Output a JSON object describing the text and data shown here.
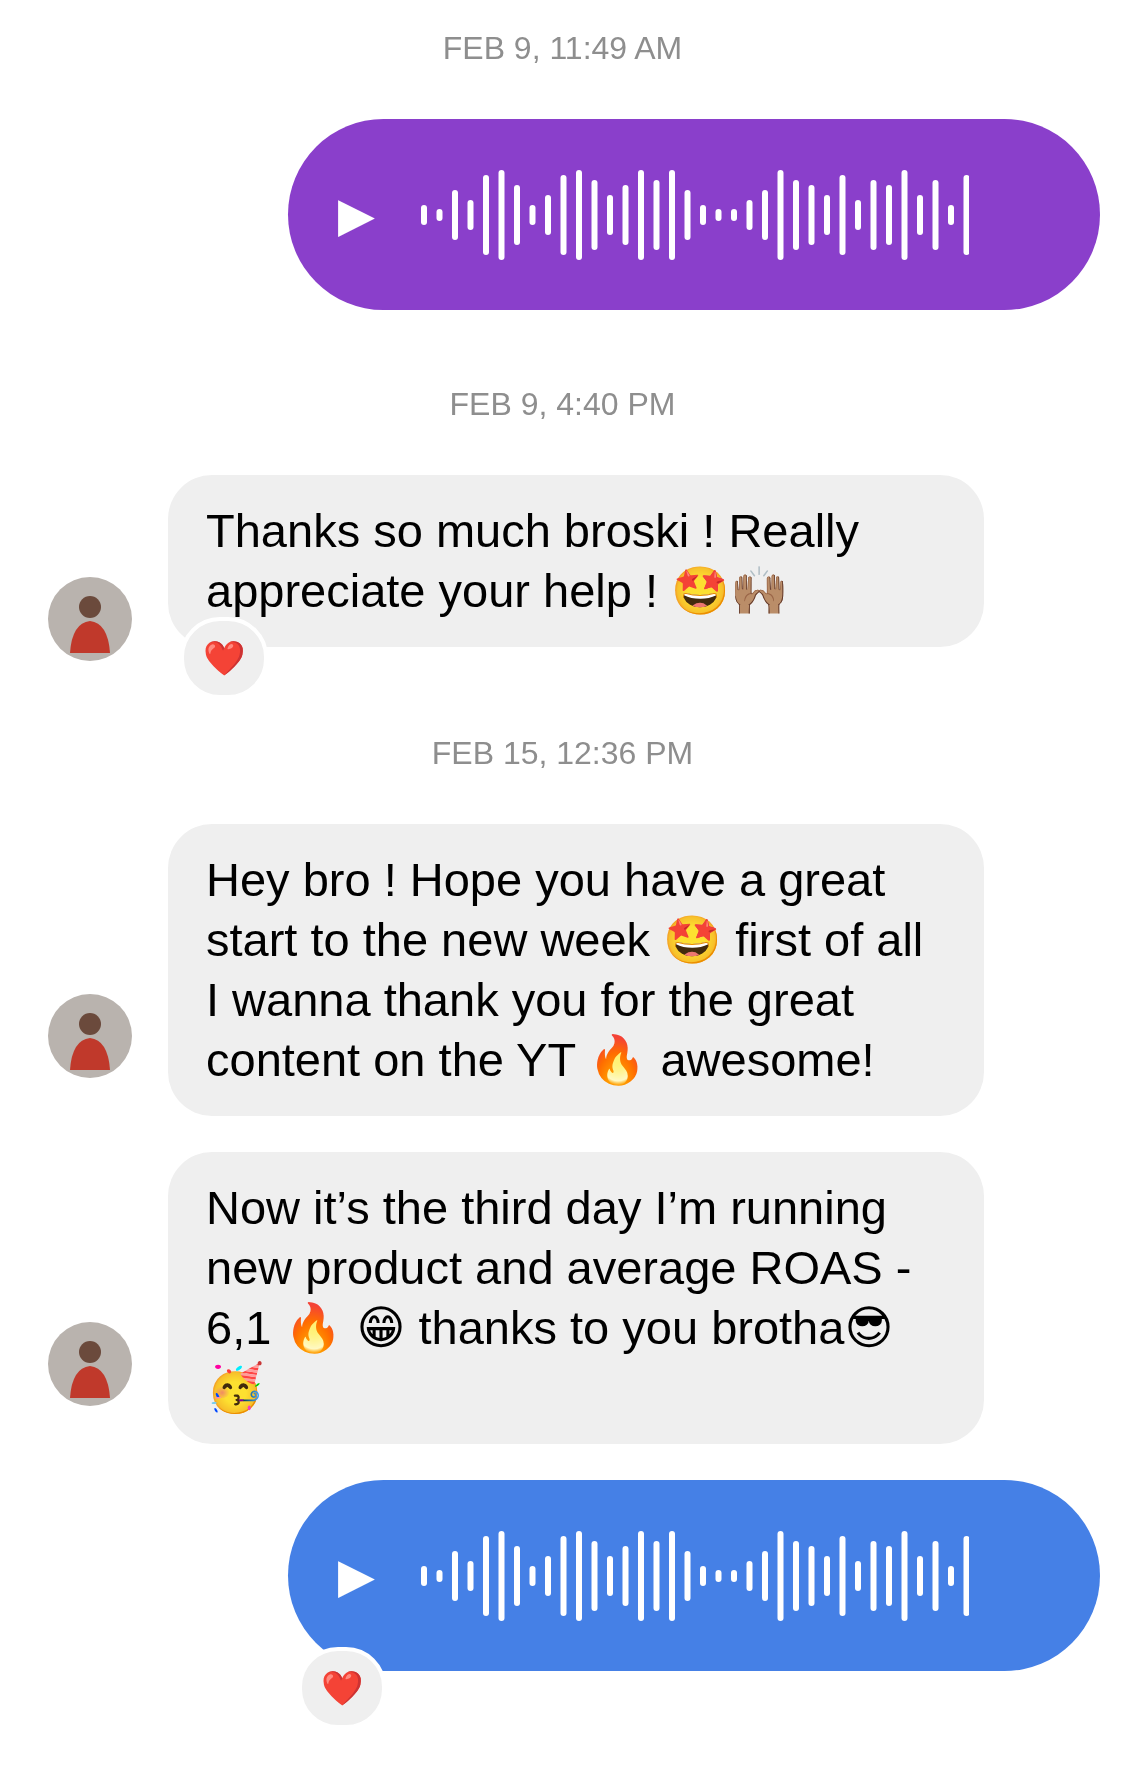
{
  "messages": [
    {
      "kind": "timestamp",
      "text": "FEB 9, 11:49 AM"
    },
    {
      "kind": "voice",
      "color": "#8a3fcb",
      "play": "▶"
    },
    {
      "kind": "timestamp",
      "text": "FEB 9, 4:40 PM"
    },
    {
      "kind": "text",
      "text": "Thanks so much broski ! Really appreciate your help ! 🤩🙌🏽",
      "reaction": "❤️"
    },
    {
      "kind": "timestamp",
      "text": "FEB 15, 12:36 PM"
    },
    {
      "kind": "text",
      "text": "Hey bro ! Hope you have a great start to the new week 🤩 first of all I wanna thank you for the great content on the YT 🔥 awesome!"
    },
    {
      "kind": "text",
      "text": "Now it’s the third day I’m running new product and average ROAS - 6,1 🔥 😁 thanks to you brotha😎 🥳"
    },
    {
      "kind": "voice",
      "color": "#4580e6",
      "play": "▶",
      "reaction": "❤️"
    }
  ]
}
